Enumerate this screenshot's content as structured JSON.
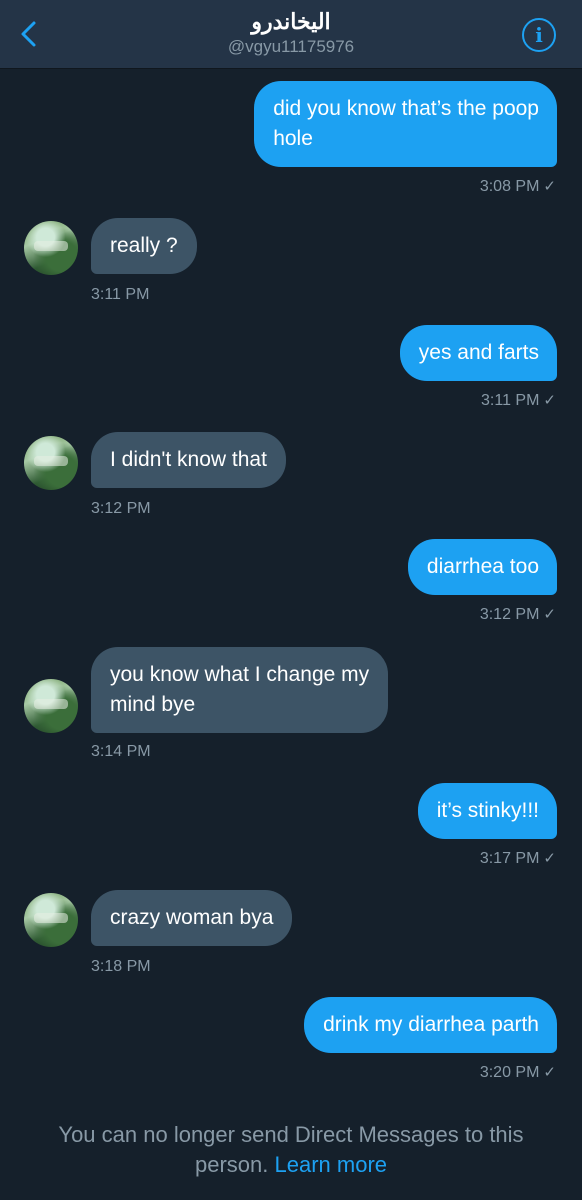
{
  "header": {
    "title": "اليخاندرو",
    "handle": "@vgyu11175976",
    "back_icon": "chevron-left-icon",
    "info_icon": "info-icon"
  },
  "messages": [
    {
      "type": "sent",
      "lines": [
        "did you know that’s the poop",
        "hole"
      ],
      "time": "3:08 PM"
    },
    {
      "type": "recv",
      "lines": [
        "really ?"
      ],
      "time": "3:11 PM"
    },
    {
      "type": "sent",
      "lines": [
        "yes and farts"
      ],
      "time": "3:11 PM"
    },
    {
      "type": "recv",
      "lines": [
        "I didn't know that"
      ],
      "time": "3:12 PM"
    },
    {
      "type": "sent",
      "lines": [
        "diarrhea too"
      ],
      "time": "3:12 PM"
    },
    {
      "type": "recv",
      "lines": [
        "you know what I change my",
        "mind bye"
      ],
      "time": "3:14 PM"
    },
    {
      "type": "sent",
      "lines": [
        "it’s stinky!!!"
      ],
      "time": "3:17 PM"
    },
    {
      "type": "recv",
      "lines": [
        "crazy woman bya"
      ],
      "time": "3:18 PM"
    },
    {
      "type": "sent",
      "lines": [
        "drink my diarrhea parth"
      ],
      "time": "3:20 PM"
    }
  ],
  "footer": {
    "text_line1": "You can no longer send Direct Messages to this",
    "text_line2": "person.",
    "link": "Learn more"
  },
  "colors": {
    "background": "#15202b",
    "header": "#243447",
    "accent": "#1da1f2",
    "received_bubble": "#3d5466",
    "muted_text": "#8899a6"
  }
}
